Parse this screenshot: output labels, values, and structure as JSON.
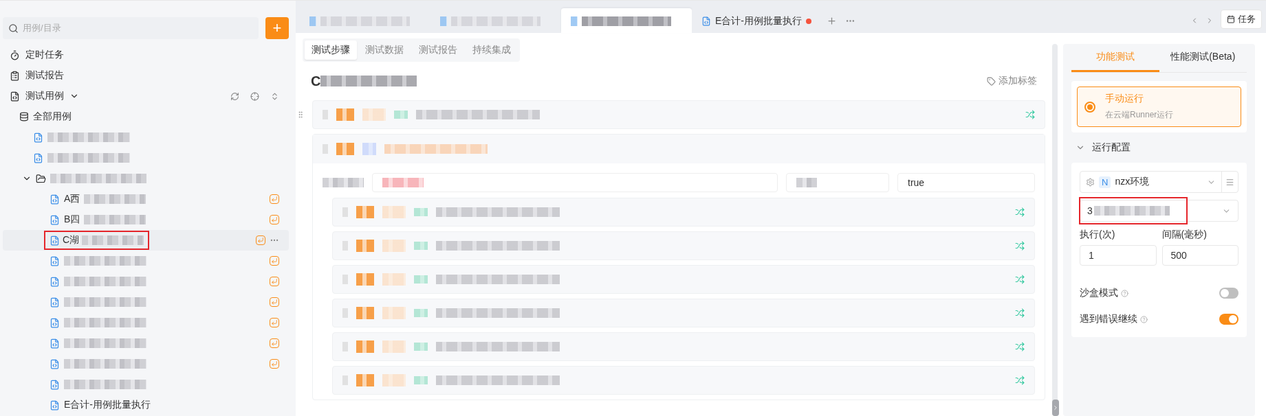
{
  "sidebar": {
    "search": {
      "placeholder": "用例/目录"
    },
    "add_button": "+",
    "nav": [
      {
        "kind": "timer",
        "label": "定时任务"
      },
      {
        "kind": "report",
        "label": "测试报告"
      },
      {
        "kind": "cases",
        "label": "测试用例",
        "expanded": true
      }
    ],
    "tree": {
      "label": "全部用例",
      "children": [
        {
          "kind": "case",
          "blurred": true,
          "badge": false,
          "selected": false,
          "highlighted": false
        },
        {
          "kind": "case",
          "blurred": true,
          "badge": false,
          "selected": false,
          "highlighted": false
        },
        {
          "kind": "folder",
          "blurred": true,
          "expanded": true,
          "children": [
            {
              "kind": "case",
              "label": "A西",
              "blurred": true,
              "badge": true,
              "selected": false,
              "highlighted": false
            },
            {
              "kind": "case",
              "label": "B四",
              "blurred": true,
              "badge": true,
              "selected": false,
              "highlighted": false
            },
            {
              "kind": "case",
              "label": "C湖",
              "blurred": true,
              "badge": true,
              "selected": true,
              "highlighted": true
            },
            {
              "kind": "case",
              "blurred": true,
              "badge": true,
              "selected": false,
              "highlighted": false
            },
            {
              "kind": "case",
              "blurred": true,
              "badge": true,
              "selected": false,
              "highlighted": false
            },
            {
              "kind": "case",
              "blurred": true,
              "badge": true,
              "selected": false,
              "highlighted": false
            },
            {
              "kind": "case",
              "blurred": true,
              "badge": true,
              "selected": false,
              "highlighted": false
            },
            {
              "kind": "case",
              "blurred": true,
              "badge": true,
              "selected": false,
              "highlighted": false
            },
            {
              "kind": "case",
              "blurred": true,
              "badge": true,
              "selected": false,
              "highlighted": false
            },
            {
              "kind": "case",
              "blurred": true,
              "badge": false,
              "selected": false,
              "highlighted": false
            },
            {
              "kind": "case",
              "label": "E合计-用例批量执行",
              "blurred": false,
              "badge": false,
              "selected": false,
              "highlighted": false
            }
          ]
        }
      ]
    }
  },
  "tabs": [
    {
      "blurred": true,
      "selected": false,
      "unsaved": false
    },
    {
      "blurred": true,
      "selected": false,
      "unsaved": false
    },
    {
      "blurred": true,
      "selected": true,
      "unsaved": false
    },
    {
      "label": "E合计-用例批量执行",
      "blurred": false,
      "selected": false,
      "unsaved": true
    }
  ],
  "tasks_button": "任务",
  "sub_tabs": [
    {
      "label": "测试步骤",
      "selected": true
    },
    {
      "label": "测试数据",
      "selected": false
    },
    {
      "label": "测试报告",
      "selected": false
    },
    {
      "label": "持续集成",
      "selected": false
    }
  ],
  "title": {
    "label": "C",
    "blurred": true
  },
  "add_tag": "添加标签",
  "steps": [
    {
      "kind": "step"
    },
    {
      "kind": "group",
      "expanded": true,
      "param_value": "true",
      "children": [
        {
          "kind": "step"
        },
        {
          "kind": "step"
        },
        {
          "kind": "step"
        },
        {
          "kind": "step"
        },
        {
          "kind": "step"
        },
        {
          "kind": "step"
        }
      ]
    }
  ],
  "run_panel": {
    "tabs": [
      {
        "label": "功能测试",
        "selected": true
      },
      {
        "label": "性能测试(Beta)",
        "selected": false
      }
    ],
    "run_option": {
      "title": "手动运行",
      "description": "在云端Runner运行",
      "selected": true
    },
    "config": {
      "title": "运行配置",
      "expanded": true,
      "environment": {
        "badge": "N",
        "name": "nzx环境"
      },
      "dataset": {
        "label": "3",
        "blurred": true,
        "highlighted": true
      },
      "fields": [
        {
          "label": "执行(次)",
          "value": "1"
        },
        {
          "label": "间隔(毫秒)",
          "value": "500"
        }
      ],
      "toggles": [
        {
          "label": "沙盒模式",
          "on": false
        },
        {
          "label": "遇到错误继续",
          "on": true
        }
      ]
    }
  }
}
